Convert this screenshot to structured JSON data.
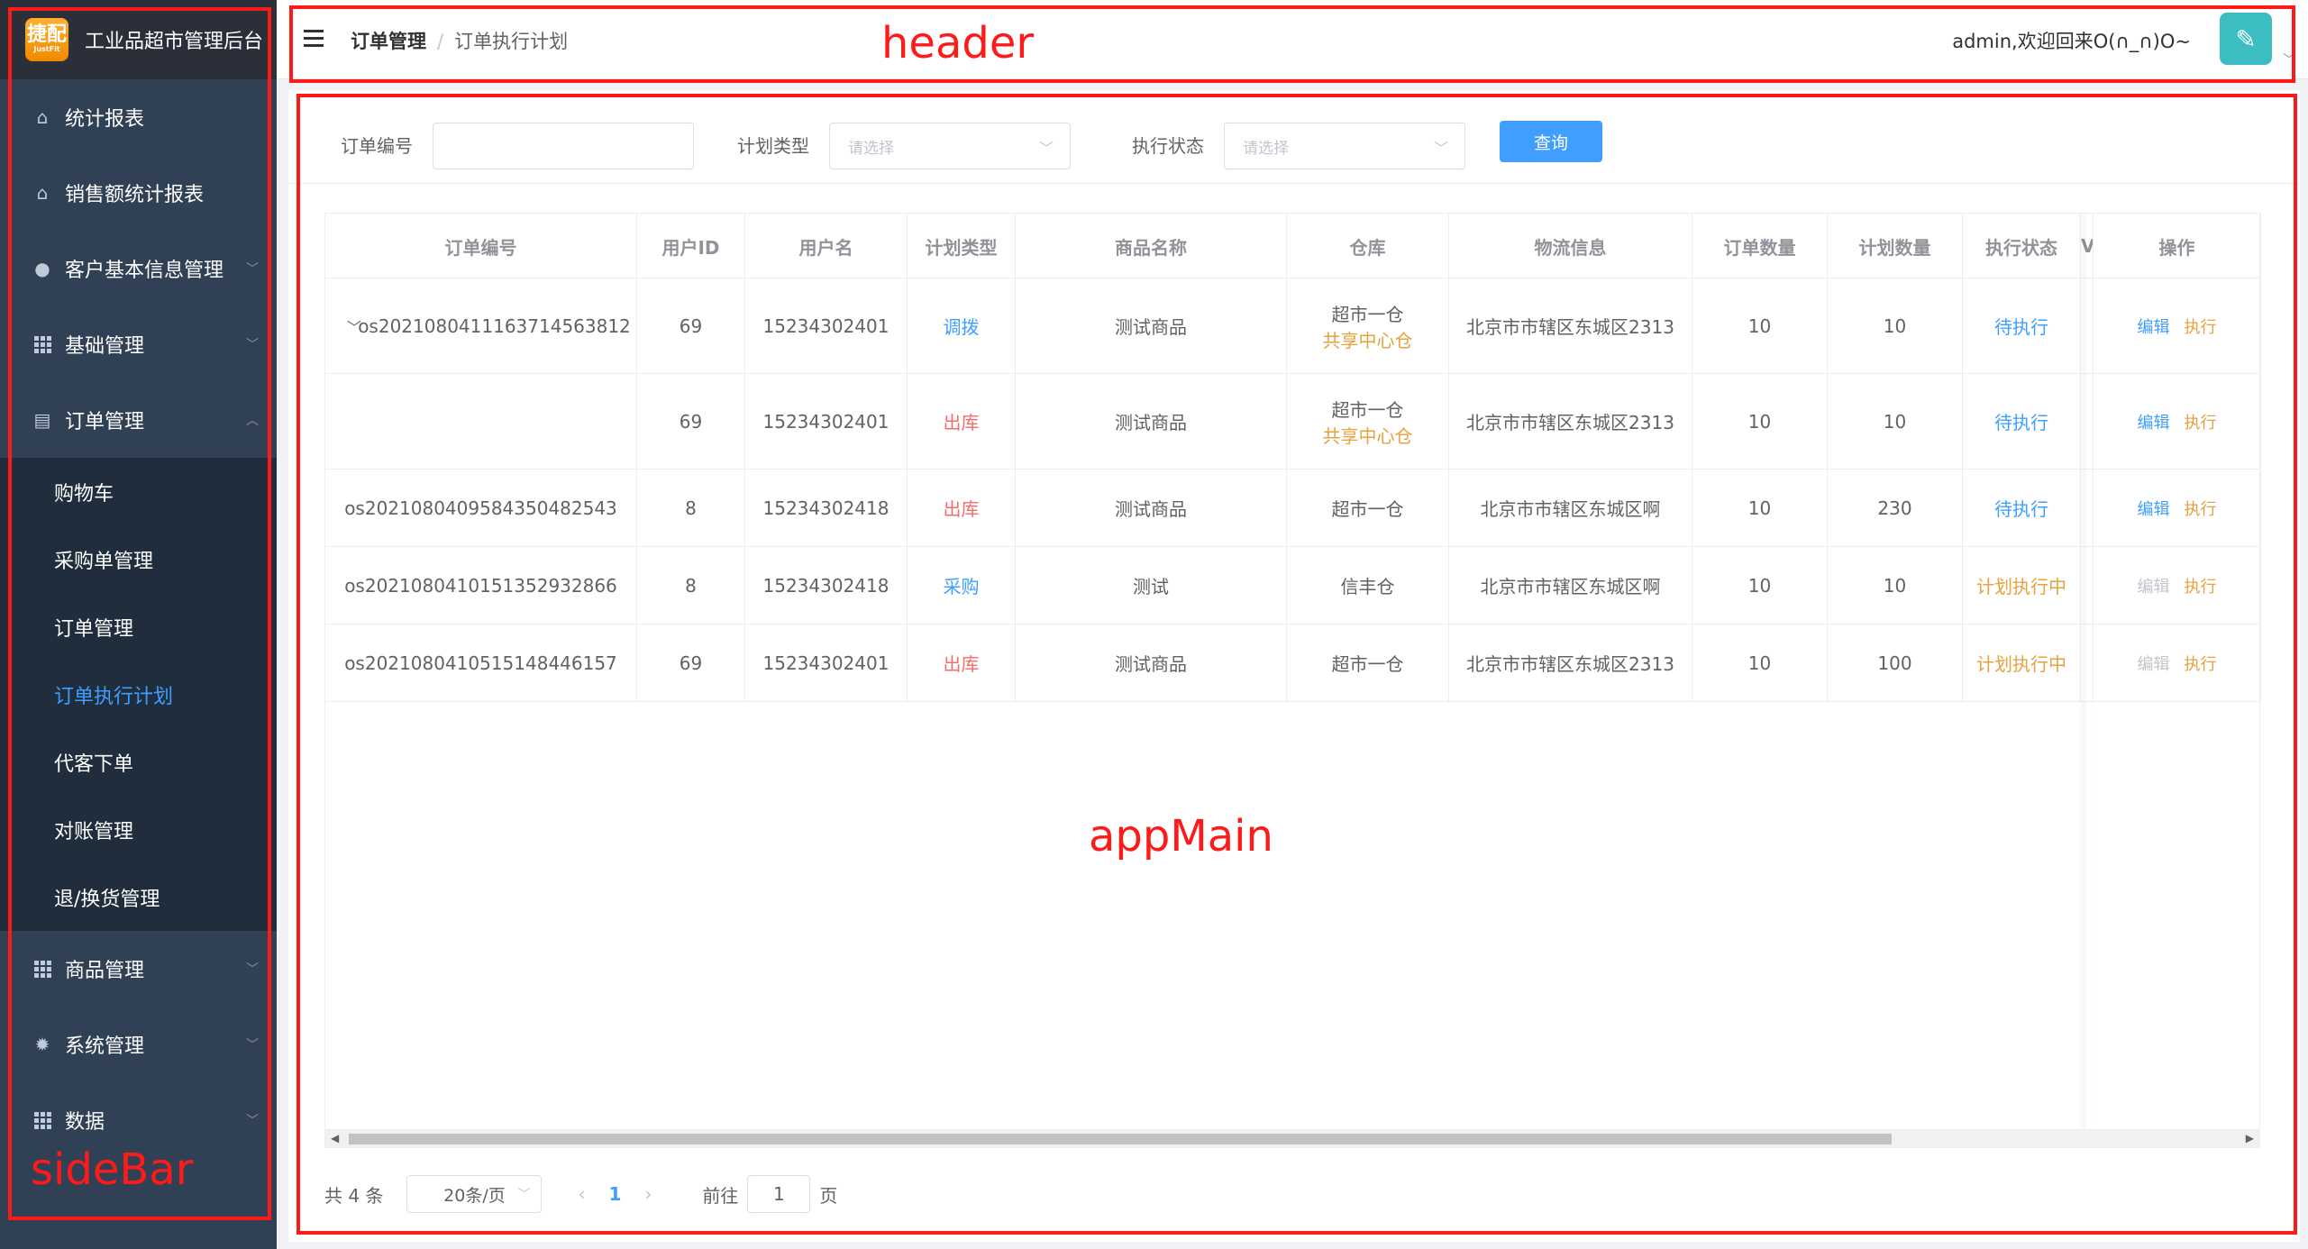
{
  "sidebar": {
    "logo_line1": "捷配",
    "logo_line2": "JustFit",
    "title": "工业品超市管理后台",
    "items": [
      {
        "label": "统计报表",
        "icon": "home-icon"
      },
      {
        "label": "销售额统计报表",
        "icon": "home-icon"
      },
      {
        "label": "客户基本信息管理",
        "icon": "user-icon"
      },
      {
        "label": "基础管理",
        "icon": "grid-icon"
      },
      {
        "label": "订单管理",
        "icon": "clipboard-icon"
      },
      {
        "label": "商品管理",
        "icon": "grid-icon"
      },
      {
        "label": "系统管理",
        "icon": "gear-icon"
      },
      {
        "label": "数据",
        "icon": "grid-icon"
      }
    ],
    "sub_items": [
      "购物车",
      "采购单管理",
      "订单管理",
      "订单执行计划",
      "代客下单",
      "对账管理",
      "退/换货管理"
    ]
  },
  "header": {
    "breadcrumb_1": "订单管理",
    "breadcrumb_sep": "/",
    "breadcrumb_2": "订单执行计划",
    "welcome": "admin,欢迎回来O(∩_∩)O~"
  },
  "filters": {
    "order_no_label": "订单编号",
    "plan_type_label": "计划类型",
    "plan_type_placeholder": "请选择",
    "exec_status_label": "执行状态",
    "exec_status_placeholder": "请选择",
    "query_button": "查询"
  },
  "table": {
    "columns": [
      "订单编号",
      "用户ID",
      "用户名",
      "计划类型",
      "商品名称",
      "仓库",
      "物流信息",
      "订单数量",
      "计划数量",
      "执行状态",
      "V",
      "操作"
    ],
    "rows": [
      {
        "order_no": "os2021080411163714563812",
        "user_id": "69",
        "username": "15234302401",
        "plan_type": "调拨",
        "plan_color": "#409eff",
        "product": "测试商品",
        "warehouse": "超市一仓",
        "warehouse_sub": "共享中心仓",
        "logistics": "北京市市辖区东城区2313",
        "order_qty": "10",
        "plan_qty": "10",
        "status": "待执行",
        "status_color": "#409eff",
        "edit": "编辑",
        "edit_color": "#409eff",
        "exec": "执行"
      },
      {
        "order_no": "",
        "user_id": "69",
        "username": "15234302401",
        "plan_type": "出库",
        "plan_color": "#f56c6c",
        "product": "测试商品",
        "warehouse": "超市一仓",
        "warehouse_sub": "共享中心仓",
        "logistics": "北京市市辖区东城区2313",
        "order_qty": "10",
        "plan_qty": "10",
        "status": "待执行",
        "status_color": "#409eff",
        "edit": "编辑",
        "edit_color": "#409eff",
        "exec": "执行"
      },
      {
        "order_no": "os2021080409584350482543",
        "user_id": "8",
        "username": "15234302418",
        "plan_type": "出库",
        "plan_color": "#f56c6c",
        "product": "测试商品",
        "warehouse": "超市一仓",
        "warehouse_sub": "",
        "logistics": "北京市市辖区东城区啊",
        "order_qty": "10",
        "plan_qty": "230",
        "status": "待执行",
        "status_color": "#409eff",
        "edit": "编辑",
        "edit_color": "#409eff",
        "exec": "执行"
      },
      {
        "order_no": "os2021080410151352932866",
        "user_id": "8",
        "username": "15234302418",
        "plan_type": "采购",
        "plan_color": "#409eff",
        "product": "测试",
        "warehouse": "信丰仓",
        "warehouse_sub": "",
        "logistics": "北京市市辖区东城区啊",
        "order_qty": "10",
        "plan_qty": "10",
        "status": "计划执行中",
        "status_color": "#e6a23c",
        "edit": "编辑",
        "edit_color": "#c0c4cc",
        "exec": "执行"
      },
      {
        "order_no": "os2021080410515148446157",
        "user_id": "69",
        "username": "15234302401",
        "plan_type": "出库",
        "plan_color": "#f56c6c",
        "product": "测试商品",
        "warehouse": "超市一仓",
        "warehouse_sub": "",
        "logistics": "北京市市辖区东城区2313",
        "order_qty": "10",
        "plan_qty": "100",
        "status": "计划执行中",
        "status_color": "#e6a23c",
        "edit": "编辑",
        "edit_color": "#c0c4cc",
        "exec": "执行"
      }
    ]
  },
  "pagination": {
    "total": "共 4 条",
    "page_size": "20条/页",
    "current_page": "1",
    "goto_label": "前往",
    "goto_value": "1",
    "page_suffix": "页"
  },
  "annotations": {
    "header": "header",
    "appmain": "appMain",
    "sidebar": "sideBar",
    "color": "#ff1a1a"
  }
}
